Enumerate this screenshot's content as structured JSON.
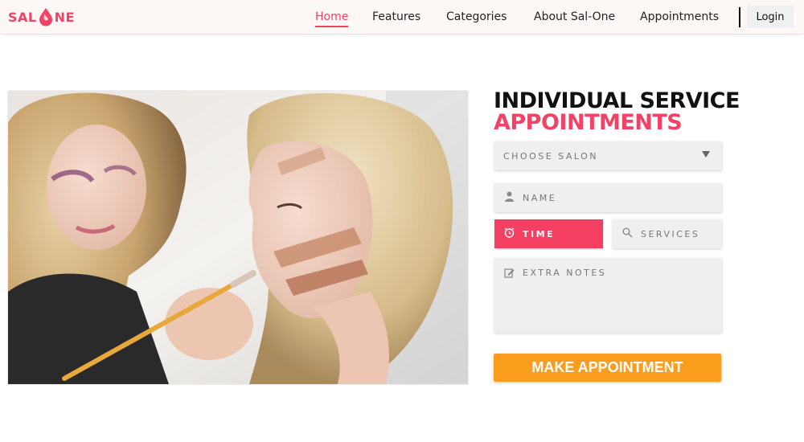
{
  "brand": {
    "logo_text_left": "SAL",
    "logo_text_right": "NE",
    "accent_color": "#f24266",
    "button_color": "#fb9d1c"
  },
  "nav": {
    "items": [
      {
        "label": "Home",
        "active": true
      },
      {
        "label": "Features",
        "active": false
      },
      {
        "label": "Categories",
        "active": false
      },
      {
        "label": "About Sal-One",
        "active": false
      },
      {
        "label": "Appointments",
        "active": false
      }
    ],
    "login_label": "Login"
  },
  "hero": {
    "icon": "makeup-artist-photo"
  },
  "form": {
    "title_line1": "INDIVIDUAL SERVICE",
    "title_line2": "APPOINTMENTS",
    "salon_select": {
      "placeholder": "CHOOSE SALON",
      "icon": "chevron-down-icon"
    },
    "name_field": {
      "placeholder": "NAME",
      "icon": "user-icon"
    },
    "time_field": {
      "placeholder": "TIME",
      "icon": "alarm-clock-icon"
    },
    "services_field": {
      "placeholder": "SERVICES",
      "icon": "search-icon"
    },
    "notes_field": {
      "placeholder": "EXTRA NOTES",
      "icon": "edit-icon"
    },
    "submit_label": "MAKE APPOINTMENT"
  }
}
